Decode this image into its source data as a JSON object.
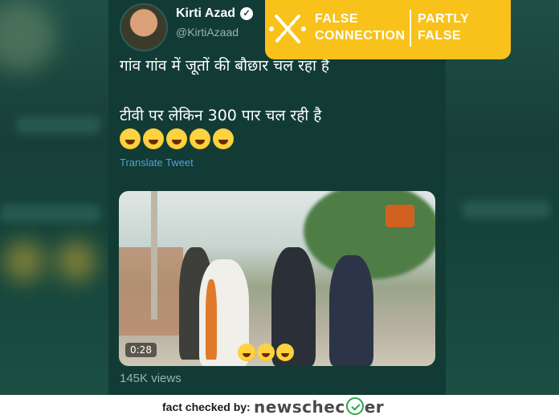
{
  "tweet": {
    "author_name": "Kirti Azad",
    "handle": "@KirtiAzaad",
    "verified_icon": "verified-badge-icon",
    "text_line_1": "गांव गांव में जूतों की बौछार चल रहा है",
    "text_line_2": "टीवी पर लेकिन 300 पार चल रही है",
    "emoji_icon": "rolling-laughing-emoji-icon",
    "emoji_count": 5,
    "translate_label": "Translate Tweet",
    "video": {
      "duration": "0:28",
      "overlay_emoji_count": 3
    },
    "views": "145K views"
  },
  "verdict": {
    "label_left_1": "FALSE",
    "label_left_2": "CONNECTION",
    "label_right_1": "PARTLY",
    "label_right_2": "FALSE",
    "icon": "false-connection-icon",
    "color": "#f8c21b"
  },
  "footer": {
    "label": "fact checked by:",
    "brand_prefix": "newschec",
    "brand_suffix": "er",
    "brand_icon": "checkmark-circle-icon",
    "brand_color": "#2aa84a"
  }
}
